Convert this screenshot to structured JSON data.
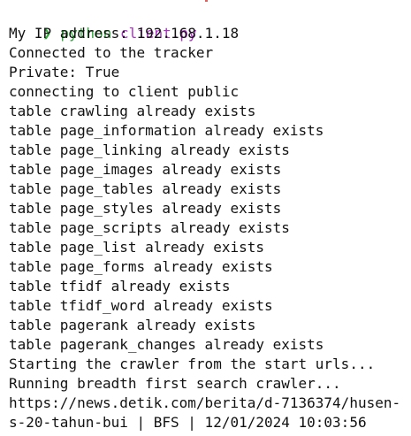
{
  "prompt": {
    "symbol": "❯",
    "command": "python",
    "argument": "client.py",
    "colors": {
      "command": "#2faa3a",
      "argument": "#b02fc9"
    }
  },
  "output_lines": [
    "My IP address: 192.168.1.18",
    "Connected to the tracker",
    "Private: True",
    "connecting to client public",
    "table crawling already exists",
    "table page_information already exists",
    "table page_linking already exists",
    "table page_images already exists",
    "table page_tables already exists",
    "table page_styles already exists",
    "table page_scripts already exists",
    "table page_list already exists",
    "table page_forms already exists",
    "table tfidf already exists",
    "table tfidf_word already exists",
    "table pagerank already exists",
    "table pagerank_changes already exists",
    "Starting the crawler from the start urls...",
    "Running breadth first search crawler...",
    "https://news.detik.com/berita/d-7136374/husen-",
    "s-20-tahun-bui | BFS | 12/01/2024 10:03:56"
  ]
}
